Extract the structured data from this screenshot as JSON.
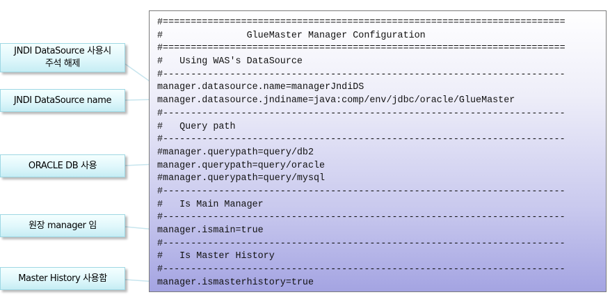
{
  "config_lines": [
    "#========================================================================",
    "#               GlueMaster Manager Configuration",
    "#========================================================================",
    "#   Using WAS's DataSource",
    "#------------------------------------------------------------------------",
    "manager.datasource.name=managerJndiDS",
    "manager.datasource.jndiname=java:comp/env/jdbc/oracle/GlueMaster",
    "#------------------------------------------------------------------------",
    "#   Query path",
    "#------------------------------------------------------------------------",
    "#manager.querypath=query/db2",
    "manager.querypath=query/oracle",
    "#manager.querypath=query/mysql",
    "#------------------------------------------------------------------------",
    "#   Is Main Manager",
    "#------------------------------------------------------------------------",
    "manager.ismain=true",
    "#------------------------------------------------------------------------",
    "#   Is Master History",
    "#------------------------------------------------------------------------",
    "manager.ismasterhistory=true"
  ],
  "callouts": [
    {
      "name": "callout-jndi-datasource-usage",
      "lines": [
        "JNDI DataSource 사용시",
        "주석 해제"
      ]
    },
    {
      "name": "callout-jndi-datasource-name",
      "lines": [
        "JNDI DataSource name"
      ]
    },
    {
      "name": "callout-oracle-db",
      "lines": [
        "ORACLE DB 사용"
      ]
    },
    {
      "name": "callout-main-manager",
      "lines": [
        "원장 manager 임"
      ]
    },
    {
      "name": "callout-master-history",
      "lines": [
        "Master History  사용함"
      ]
    }
  ],
  "colors": {
    "panel_gradient_top": "#ffffff",
    "panel_gradient_bottom": "#a4a4e2",
    "callout_fill": "#dff7fb",
    "callout_border": "#9fd8e4",
    "leader_line": "#bfe3ee"
  }
}
